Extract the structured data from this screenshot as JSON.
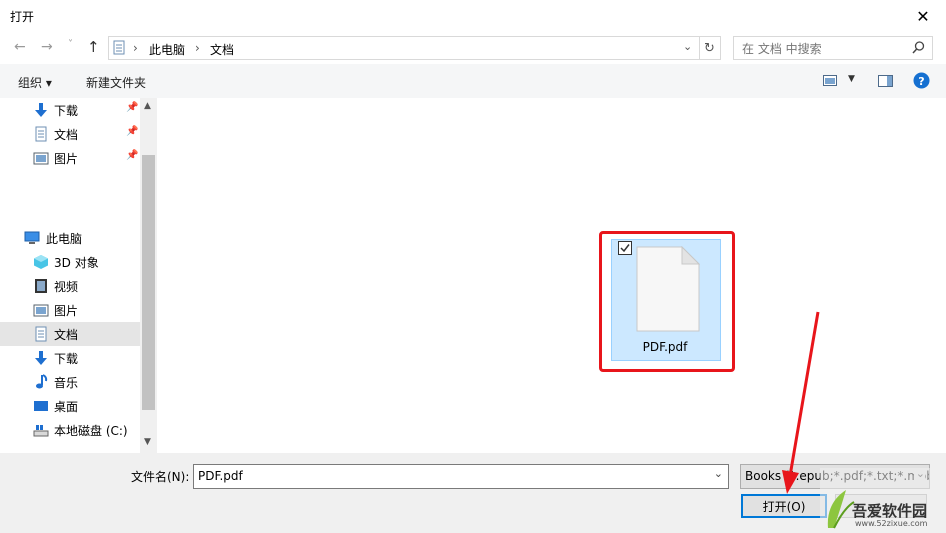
{
  "window": {
    "title": "打开",
    "close_glyph": "✕"
  },
  "nav": {
    "back": "←",
    "forward": "→",
    "dropdown": "˅",
    "up": "↑",
    "breadcrumb": [
      "此电脑",
      "文档"
    ],
    "separator": "›",
    "refresh": "↻",
    "search_placeholder": "在 文档 中搜索"
  },
  "toolbar": {
    "organize": "组织 ▾",
    "new_folder": "新建文件夹"
  },
  "sidebar": {
    "quick_access": [
      {
        "label": "下载",
        "icon": "download-icon",
        "pinned": true
      },
      {
        "label": "文档",
        "icon": "document-icon",
        "pinned": true
      },
      {
        "label": "图片",
        "icon": "pictures-icon",
        "pinned": true
      }
    ],
    "this_pc": {
      "label": "此电脑",
      "icon": "computer-icon"
    },
    "pc_items": [
      {
        "label": "3D 对象",
        "icon": "3d-objects-icon"
      },
      {
        "label": "视频",
        "icon": "videos-icon"
      },
      {
        "label": "图片",
        "icon": "pictures-icon"
      },
      {
        "label": "文档",
        "icon": "document-icon",
        "selected": true
      },
      {
        "label": "下载",
        "icon": "download-icon"
      },
      {
        "label": "音乐",
        "icon": "music-icon"
      },
      {
        "label": "桌面",
        "icon": "desktop-icon"
      },
      {
        "label": "本地磁盘 (C:)",
        "icon": "drive-icon"
      }
    ]
  },
  "content": {
    "file": {
      "name": "PDF.pdf",
      "checked": true
    }
  },
  "footer": {
    "filename_label": "文件名(N):",
    "filename_value": "PDF.pdf",
    "filetype_value": "Books (*.epub;*.pdf;*.txt;*.mobi)",
    "open_label": "打开(O)",
    "cancel_label": ""
  },
  "watermark": {
    "site": "吾爱软件园",
    "url": "www.52zixue.com"
  },
  "colors": {
    "accent": "#0078d7",
    "highlight": "#e8151b",
    "arrow": "#e8151b",
    "selection": "#cce8ff"
  }
}
